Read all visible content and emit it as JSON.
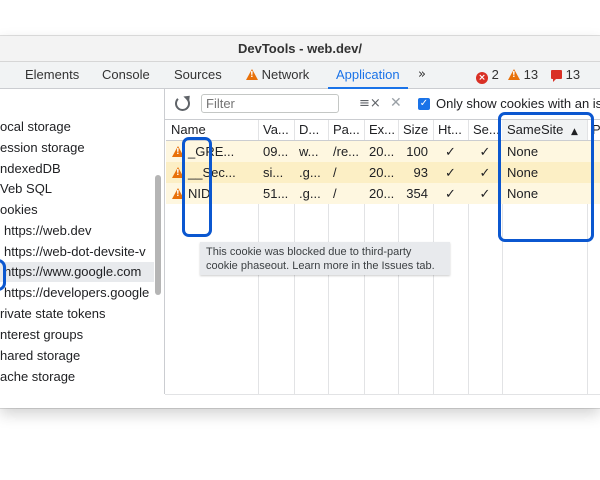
{
  "window": {
    "title": "DevTools - web.dev/"
  },
  "tabs": [
    {
      "label": "Elements"
    },
    {
      "label": "Console"
    },
    {
      "label": "Sources"
    },
    {
      "label": "Network"
    },
    {
      "label": "Application"
    }
  ],
  "more_tabs": "»",
  "counters": {
    "errors": "2",
    "warnings": "13",
    "issues": "13"
  },
  "sidebar": {
    "items": [
      {
        "label": "ocal storage"
      },
      {
        "label": "ession storage"
      },
      {
        "label": "ndexedDB"
      },
      {
        "label": "Veb SQL"
      },
      {
        "label": "ookies"
      },
      {
        "label": "https://web.dev"
      },
      {
        "label": "https://web-dot-devsite-v"
      },
      {
        "label": "https://www.google.com"
      },
      {
        "label": "https://developers.google"
      },
      {
        "label": "rivate state tokens"
      },
      {
        "label": "nterest groups"
      },
      {
        "label": "hared storage"
      },
      {
        "label": "ache storage"
      }
    ]
  },
  "toolbar": {
    "filter_placeholder": "Filter",
    "clear_glyph": "≡×",
    "close_glyph": "✕",
    "checkbox_glyph": "✓",
    "only_issues_label": "Only show cookies with an is"
  },
  "table": {
    "columns": [
      "Name",
      "Va...",
      "D...",
      "Pa...",
      "Ex...",
      "Size",
      "Ht...",
      "Se...",
      "SameSite",
      "P"
    ],
    "sort_indicator": "▲",
    "rows": [
      {
        "name": "_GRE...",
        "value": "09...",
        "domain": "w...",
        "path": "/re...",
        "expires": "20...",
        "size": "100",
        "httponly": "✓",
        "secure": "✓",
        "samesite": "None"
      },
      {
        "name": "__Sec...",
        "value": "si...",
        "domain": ".g...",
        "path": "/",
        "expires": "20...",
        "size": "93",
        "httponly": "✓",
        "secure": "✓",
        "samesite": "None"
      },
      {
        "name": "NID",
        "value": "51...",
        "domain": ".g...",
        "path": "/",
        "expires": "20...",
        "size": "354",
        "httponly": "✓",
        "secure": "✓",
        "samesite": "None"
      }
    ]
  },
  "tooltip": {
    "text": "This cookie was blocked due to third-party cookie phaseout. Learn more in the Issues tab."
  },
  "colors": {
    "accent": "#1a73e8",
    "highlight": "#0b57d0",
    "warning": "#e8710a",
    "error": "#d93025",
    "blocked_row": "#fef7e0"
  }
}
